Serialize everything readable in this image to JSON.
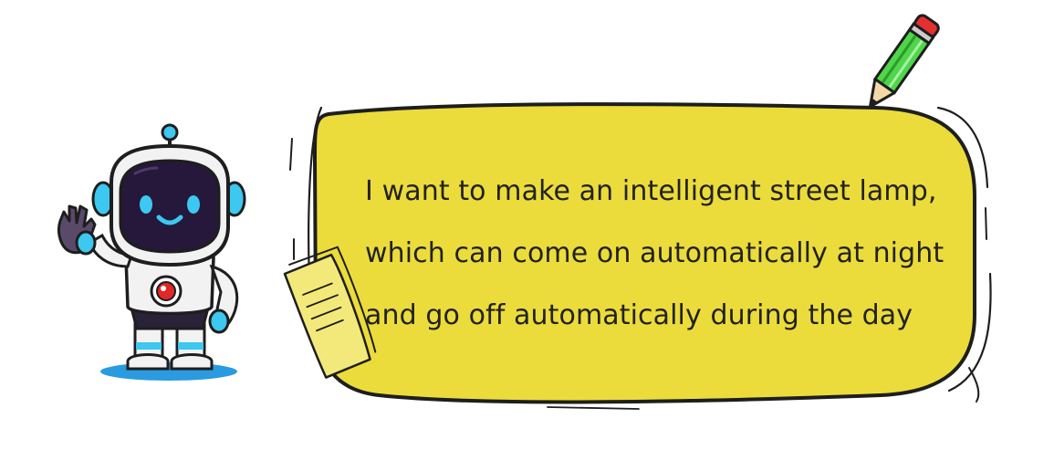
{
  "speech_bubble": {
    "lines": [
      "I want to make an intelligent street lamp,",
      "which can come on automatically at night",
      "and go off automatically during the day"
    ]
  },
  "colors": {
    "bubble_fill": "#EBDC3C",
    "outline": "#1E1E1E",
    "robot_body": "#F2F2F2",
    "robot_face": "#25183A",
    "robot_accent": "#3CC8F0",
    "core_red": "#E02828",
    "pencil_green": "#4FD64A",
    "pencil_eraser": "#E53030",
    "note_yellow": "#F3E97A",
    "shadow_blue": "#2A9BE0"
  },
  "icons": {
    "robot": "waving-robot-icon",
    "pencil": "pencil-icon",
    "note": "sticky-note-icon"
  }
}
